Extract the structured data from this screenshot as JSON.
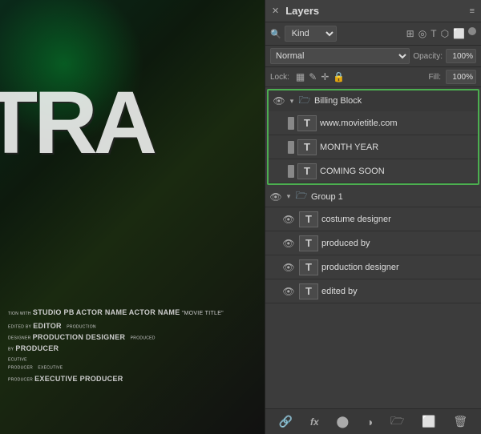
{
  "poster": {
    "title_text": "TRA",
    "credits": [
      {
        "line": "TION WITH STUDIO PB ACTOR NAME ACTOR NAME \"MOVIE TITLE\""
      },
      {
        "line": "EDITED BY EDITOR   PRODUCTION DESIGNER   PRODUCED BY PRODUCER"
      },
      {
        "line": "ECUTIVE PRODUCER   EXECUTIVE EXECUTIVE PRODUCER"
      }
    ]
  },
  "layers_panel": {
    "title": "Layers",
    "close_label": "✕",
    "menu_label": "≡",
    "filter": {
      "label": "🔍",
      "select_default": "Kind",
      "icons": [
        "img",
        "adj",
        "T",
        "shape",
        "smart",
        "dot"
      ]
    },
    "blend": {
      "mode": "Normal",
      "opacity_label": "Opacity:",
      "opacity_value": "100%"
    },
    "lock": {
      "label": "Lock:",
      "icons": [
        "▦",
        "✎",
        "✛",
        "🔒"
      ],
      "fill_label": "Fill:",
      "fill_value": "100%"
    },
    "billing_block": {
      "group_name": "Billing Block",
      "layers": [
        {
          "id": 1,
          "name": "www.movietitle.com",
          "type": "text"
        },
        {
          "id": 2,
          "name": "MONTH YEAR",
          "type": "text"
        },
        {
          "id": 3,
          "name": "COMING SOON",
          "type": "text"
        }
      ]
    },
    "group1": {
      "group_name": "Group 1",
      "layers": [
        {
          "id": 4,
          "name": "costume designer",
          "type": "text"
        },
        {
          "id": 5,
          "name": "produced by",
          "type": "text"
        },
        {
          "id": 6,
          "name": "production designer",
          "type": "text"
        },
        {
          "id": 7,
          "name": "edited by",
          "type": "text"
        }
      ]
    },
    "toolbar": {
      "link_label": "🔗",
      "fx_label": "fx",
      "mask_label": "⬤",
      "adjustment_label": "◑",
      "folder_label": "🗁",
      "artboard_label": "⬜",
      "trash_label": "🗑"
    }
  }
}
